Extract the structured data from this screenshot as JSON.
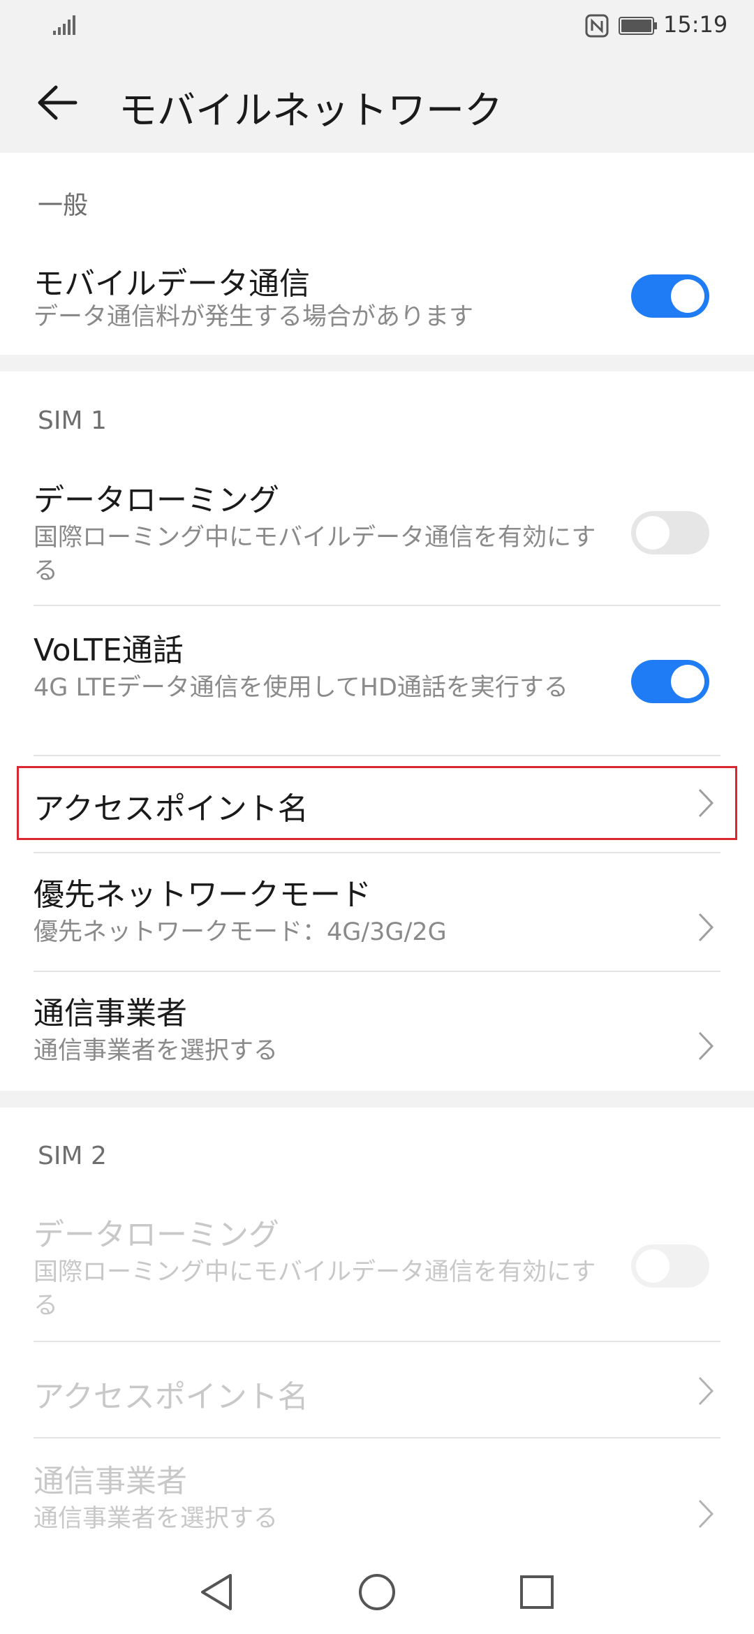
{
  "status_bar": {
    "time": "15:19"
  },
  "header": {
    "title": "モバイルネットワーク"
  },
  "general": {
    "header": "一般",
    "mobile_data": {
      "title": "モバイルデータ通信",
      "subtitle": "データ通信料が発生する場合があります",
      "enabled": true
    }
  },
  "sim1": {
    "header": "SIM 1",
    "data_roaming": {
      "title": "データローミング",
      "subtitle": "国際ローミング中にモバイルデータ通信を有効にする",
      "enabled": false
    },
    "volte": {
      "title": "VoLTE通話",
      "subtitle": "4G LTEデータ通信を使用してHD通話を実行する",
      "enabled": true
    },
    "apn": {
      "title": "アクセスポイント名"
    },
    "preferred_mode": {
      "title": "優先ネットワークモード",
      "subtitle": "優先ネットワークモード：4G/3G/2G"
    },
    "carrier": {
      "title": "通信事業者",
      "subtitle": "通信事業者を選択する"
    }
  },
  "sim2": {
    "header": "SIM 2",
    "data_roaming": {
      "title": "データローミング",
      "subtitle": "国際ローミング中にモバイルデータ通信を有効にする",
      "enabled": false
    },
    "apn": {
      "title": "アクセスポイント名"
    },
    "carrier": {
      "title": "通信事業者",
      "subtitle": "通信事業者を選択する"
    }
  },
  "colors": {
    "accent": "#1f7cf4",
    "highlight_border": "#d9262f",
    "section_gap": "#f2f2f2"
  },
  "icons": [
    "signal-icon",
    "nfc-icon",
    "battery-icon",
    "back-arrow-icon",
    "chevron-right-icon",
    "nav-back-icon",
    "nav-home-icon",
    "nav-recents-icon"
  ]
}
